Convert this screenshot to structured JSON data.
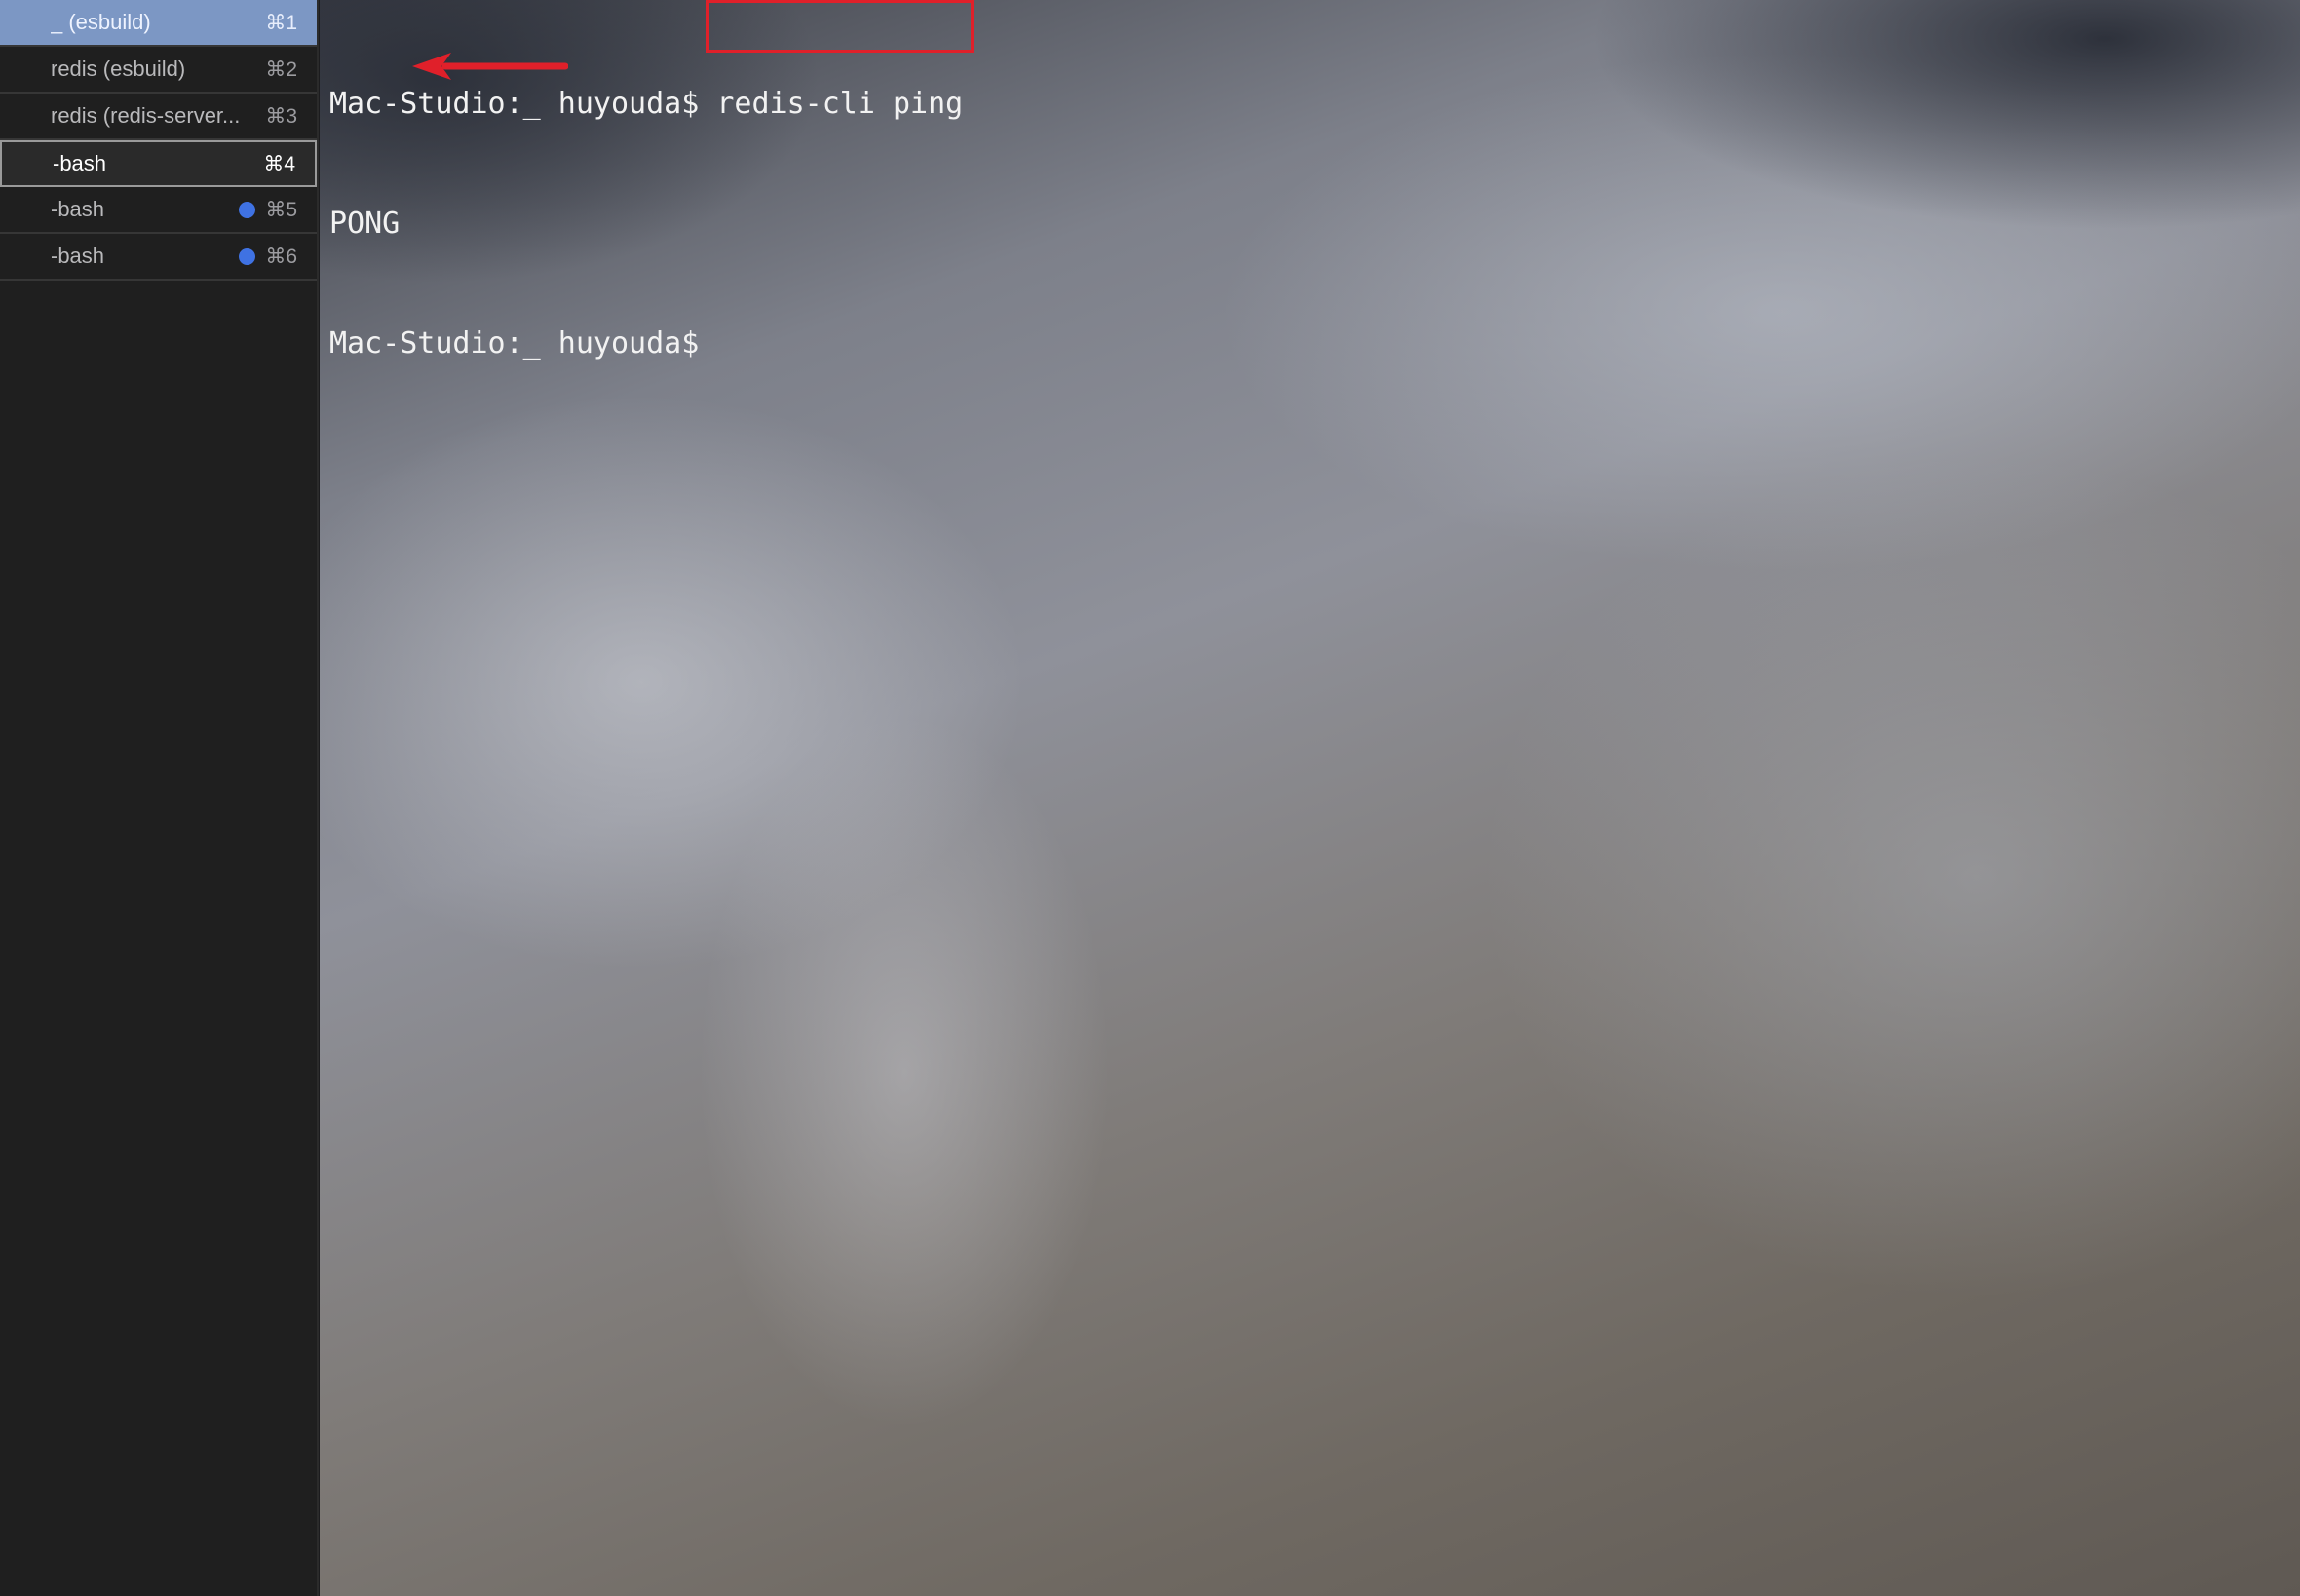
{
  "sidebar": {
    "tabs": [
      {
        "label": "_ (esbuild)",
        "shortcut": "⌘1",
        "state": "highlight",
        "activity_dot": false
      },
      {
        "label": "redis (esbuild)",
        "shortcut": "⌘2",
        "state": "normal",
        "activity_dot": false
      },
      {
        "label": "redis (redis-server...",
        "shortcut": "⌘3",
        "state": "normal",
        "activity_dot": false
      },
      {
        "label": "-bash",
        "shortcut": "⌘4",
        "state": "selected",
        "activity_dot": false
      },
      {
        "label": "-bash",
        "shortcut": "⌘5",
        "state": "normal",
        "activity_dot": true
      },
      {
        "label": "-bash",
        "shortcut": "⌘6",
        "state": "normal",
        "activity_dot": true
      }
    ]
  },
  "terminal": {
    "line1_prompt": "Mac-Studio:_ huyouda$ ",
    "line1_command": "redis-cli ping",
    "line2_output": "PONG",
    "line3_prompt": "Mac-Studio:_ huyouda$"
  },
  "colors": {
    "annotation_red": "#e0202a",
    "activity_dot": "#3f72e3",
    "highlight_tab": "#7c97c4"
  }
}
